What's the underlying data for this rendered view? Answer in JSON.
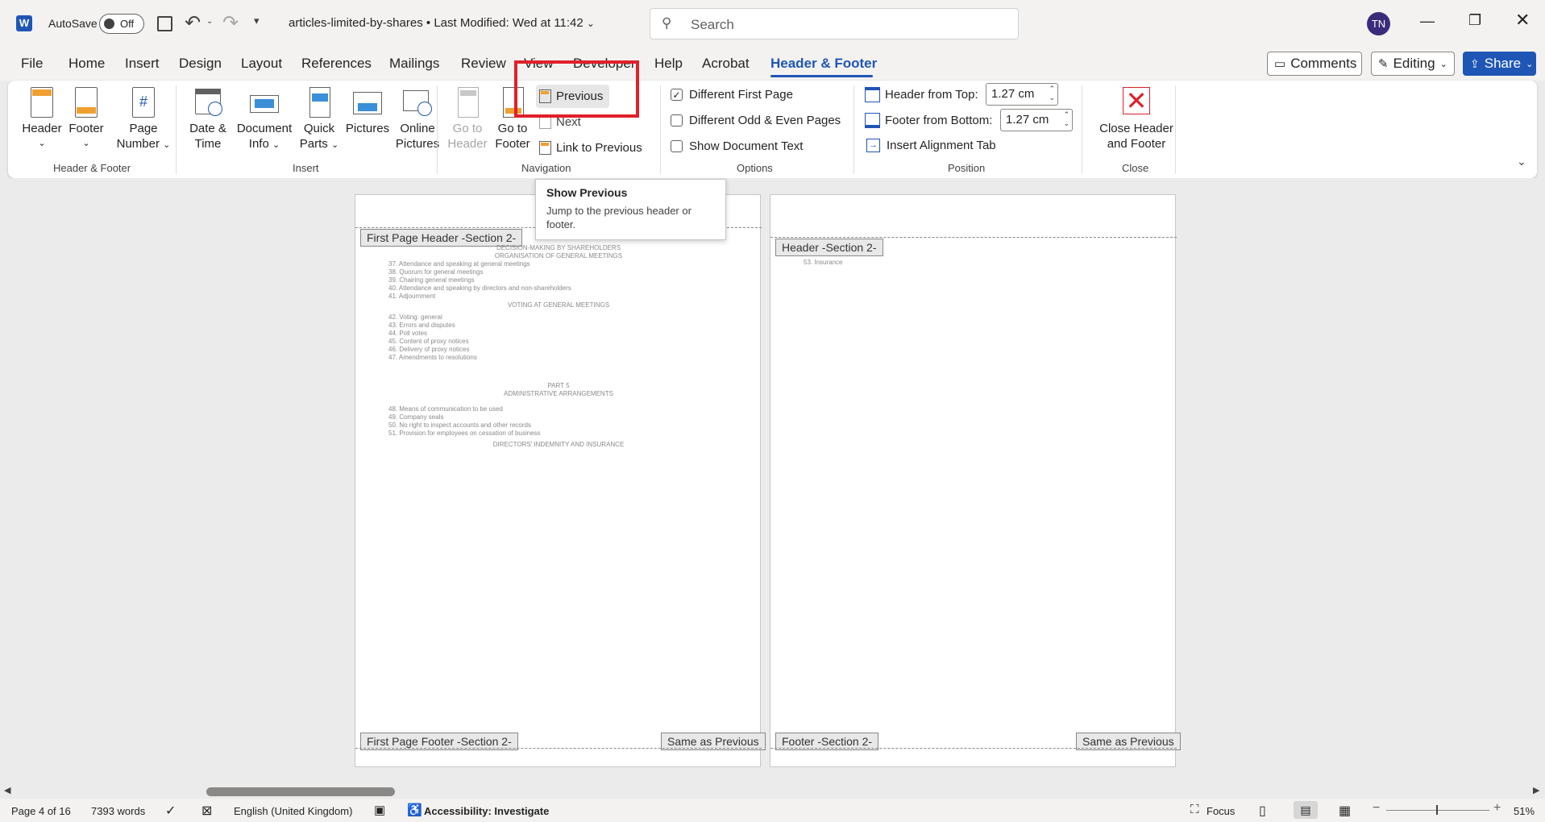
{
  "titlebar": {
    "autosave_label": "AutoSave",
    "autosave_state": "Off",
    "doc_title": "articles-limited-by-shares",
    "modified": "Last Modified: Wed at 11:42",
    "search_placeholder": "Search",
    "avatar_initials": "TN"
  },
  "tabs": [
    "File",
    "Home",
    "Insert",
    "Design",
    "Layout",
    "References",
    "Mailings",
    "Review",
    "View",
    "Developer",
    "Help",
    "Acrobat",
    "Header & Footer"
  ],
  "right_buttons": {
    "comments": "Comments",
    "editing": "Editing",
    "share": "Share"
  },
  "ribbon": {
    "hf_group": {
      "header": "Header",
      "footer": "Footer",
      "page_number_1": "Page",
      "page_number_2": "Number",
      "label": "Header & Footer"
    },
    "insert_group": {
      "date_1": "Date &",
      "date_2": "Time",
      "docinfo_1": "Document",
      "docinfo_2": "Info",
      "quick_1": "Quick",
      "quick_2": "Parts",
      "pictures": "Pictures",
      "online_1": "Online",
      "online_2": "Pictures",
      "label": "Insert"
    },
    "nav_group": {
      "goto_header_1": "Go to",
      "goto_header_2": "Header",
      "goto_footer_1": "Go to",
      "goto_footer_2": "Footer",
      "previous": "Previous",
      "next": "Next",
      "link_previous": "Link to Previous",
      "label": "Navigation"
    },
    "options_group": {
      "diff_first": "Different First Page",
      "diff_odd": "Different Odd & Even Pages",
      "show_text": "Show Document Text",
      "label": "Options"
    },
    "position_group": {
      "header_top": "Header from Top:",
      "header_top_val": "1.27 cm",
      "footer_bottom": "Footer from Bottom:",
      "footer_bottom_val": "1.27 cm",
      "align_tab": "Insert Alignment Tab",
      "label": "Position"
    },
    "close_group": {
      "close_1": "Close Header",
      "close_2": "and Footer",
      "label": "Close"
    }
  },
  "tooltip": {
    "title": "Show Previous",
    "body": "Jump to the previous header or footer."
  },
  "page1": {
    "header_tag": "First Page Header -Section 2-",
    "footer_tag": "First Page Footer -Section 2-",
    "same_as_prev": "Same as Previous",
    "lines": {
      "h1": "DECISION-MAKING BY SHAREHOLDERS",
      "h2": "ORGANISATION OF GENERAL MEETINGS",
      "l37": "37. Attendance and speaking at general meetings",
      "l38": "38. Quorum for general meetings",
      "l39": "39. Chairing general meetings",
      "l40": "40. Attendance and speaking by directors and non-shareholders",
      "l41": "41. Adjournment",
      "h3": "VOTING AT GENERAL MEETINGS",
      "l42": "42. Voting: general",
      "l43": "43. Errors and disputes",
      "l44": "44. Poll votes",
      "l45": "45. Content of proxy notices",
      "l46": "46. Delivery of proxy notices",
      "l47": "47. Amendments to resolutions",
      "h4": "PART 5",
      "h5": "ADMINISTRATIVE ARRANGEMENTS",
      "l48": "48. Means of communication to be used",
      "l49": "49. Company seals",
      "l50": "50. No right to inspect accounts and other records",
      "l51": "51. Provision for employees on cessation of business",
      "h6": "DIRECTORS' INDEMNITY AND INSURANCE"
    }
  },
  "page2": {
    "header_tag": "Header -Section 2-",
    "footer_tag": "Footer -Section 2-",
    "same_as_prev": "Same as Previous",
    "l53": "53. Insurance"
  },
  "statusbar": {
    "page": "Page 4 of 16",
    "words": "7393 words",
    "language": "English (United Kingdom)",
    "accessibility": "Accessibility: Investigate",
    "focus": "Focus",
    "zoom": "51%"
  }
}
